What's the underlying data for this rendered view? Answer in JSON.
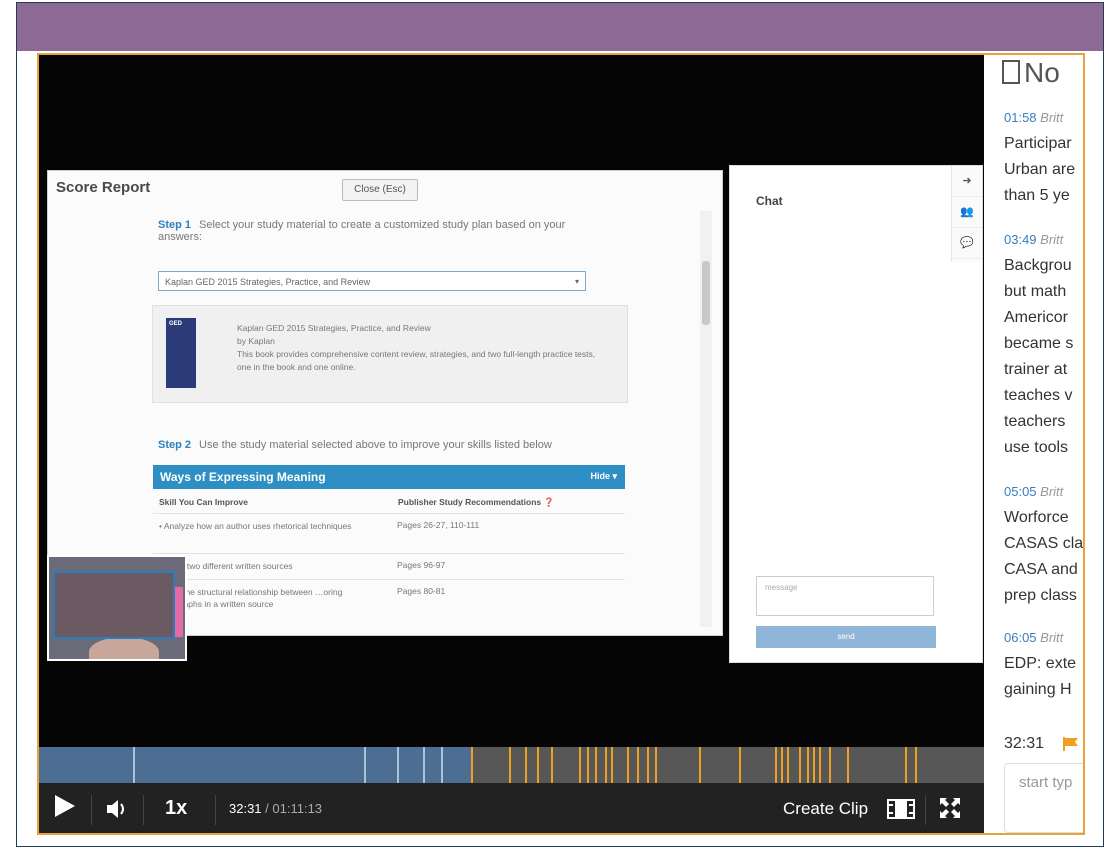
{
  "score_report": {
    "title": "Score Report",
    "close_label": "Close (Esc)",
    "step1_label": "Step 1",
    "step1_text": "Select your study material to create a customized study plan based on your answers:",
    "select_value": "Kaplan GED 2015 Strategies, Practice, and Review",
    "book": {
      "cover_text": "GED",
      "title": "Kaplan GED 2015 Strategies, Practice, and Review",
      "author": "by Kaplan",
      "description": "This book provides comprehensive content review, strategies, and two full-length practice tests, one in the book and one online."
    },
    "step2_label": "Step 2",
    "step2_text": "Use the study material selected above to improve your skills listed below",
    "table": {
      "title": "Ways of Expressing Meaning",
      "hide_label": "Hide ▾",
      "col1": "Skill You Can Improve",
      "col2": "Publisher Study Recommendations ❓",
      "rows": [
        {
          "skill": "• Analyze how an author uses rhetorical techniques",
          "pages": "Pages 26-27, 110-111"
        },
        {
          "skill": "…pare two different written sources",
          "pages": "Pages 96-97"
        },
        {
          "skill": "…yze the structural relationship between …oring paragraphs in a written source",
          "pages": "Pages 80-81"
        }
      ]
    }
  },
  "chat": {
    "title": "Chat",
    "tools": [
      "➜",
      "👥",
      "💬"
    ],
    "message_placeholder": "message",
    "send_label": "send"
  },
  "player": {
    "speed": "1x",
    "current_time": "32:31",
    "separator": " / ",
    "duration": "01:11:13",
    "create_clip_label": "Create Clip",
    "progress_fraction": 0.457
  },
  "notes": {
    "heading": "No",
    "entries": [
      {
        "time": "01:58",
        "author": "Britt",
        "lines": [
          "Participar",
          "Urban are",
          "than 5 ye"
        ]
      },
      {
        "time": "03:49",
        "author": "Britt",
        "lines": [
          "Backgrou",
          "but math",
          "Americor",
          "became s",
          "trainer at",
          "teaches v",
          "teachers",
          "use tools"
        ]
      },
      {
        "time": "05:05",
        "author": "Britt",
        "lines": [
          "Worforce",
          "CASAS cla",
          "CASA and",
          "prep class"
        ]
      },
      {
        "time": "06:05",
        "author": "Britt",
        "lines": [
          "EDP: exte",
          "gaining H"
        ]
      }
    ],
    "current_time": "32:31",
    "input_placeholder": "start typ"
  },
  "colors": {
    "top_bar": "#8d6a96",
    "accent_border": "#e8a23c",
    "timeline_played": "#4c6e93",
    "tick_color": "#f0a020",
    "link_blue": "#3a7dc0"
  }
}
